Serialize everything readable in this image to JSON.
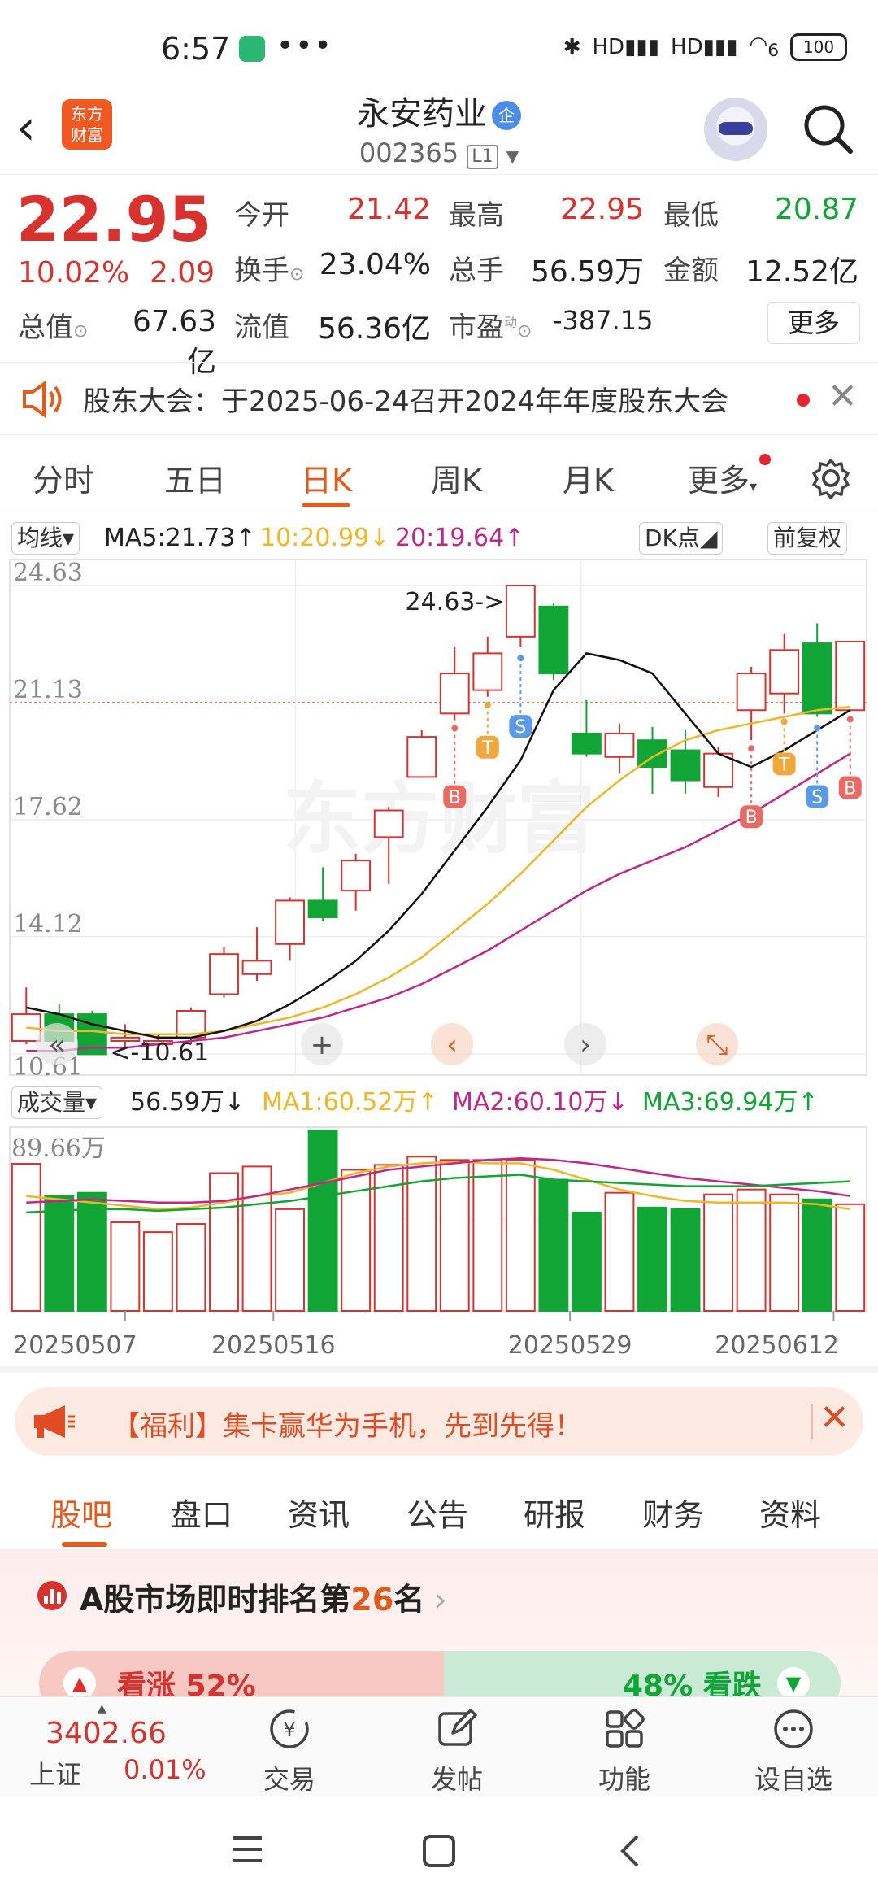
{
  "status_bar": {
    "time": "6:57",
    "dots": "•••",
    "signal1": "HD",
    "signal2": "HD",
    "wifi_label": "6",
    "battery": "100"
  },
  "header": {
    "stock_name": "永安药业",
    "badge": "企",
    "code": "002365",
    "level": "L1",
    "logo_text": "东方财富"
  },
  "quote": {
    "price": "22.95",
    "change_pct": "10.02%",
    "change_abs": "2.09",
    "open_label": "今开",
    "open": "21.42",
    "high_label": "最高",
    "high": "22.95",
    "low_label": "最低",
    "low": "20.87",
    "turnover_label": "换手",
    "turnover": "23.04%",
    "volume_label": "总手",
    "volume": "56.59万",
    "amount_label": "金额",
    "amount": "12.52亿",
    "mktcap_label": "总值",
    "mktcap": "67.63亿",
    "float_label": "流值",
    "float_cap": "56.36亿",
    "pe_label": "市盈",
    "pe_sup": "动",
    "pe": "-387.15",
    "more": "更多"
  },
  "notice": {
    "text": "股东大会：于2025-06-24召开2024年年度股东大会"
  },
  "periods": {
    "tabs": [
      "分时",
      "五日",
      "日K",
      "周K",
      "月K",
      "更多"
    ],
    "active": 2
  },
  "ma_row": {
    "selector": "均线",
    "ma5": "MA5:21.73",
    "ma10": "10:20.99",
    "ma20": "20:19.64",
    "dk": "DK点",
    "adjust": "前复权",
    "ma5_arrow": "↑",
    "ma10_arrow": "↓",
    "ma20_arrow": "↑"
  },
  "vol_row": {
    "selector": "成交量",
    "vol": "56.59万",
    "ma1": "MA1:60.52万",
    "ma2": "MA2:60.10万",
    "ma3": "MA3:69.94万",
    "vol_arrow": "↓",
    "ma1_arrow": "↑",
    "ma2_arrow": "↓",
    "ma3_arrow": "↑"
  },
  "chart_data": {
    "type": "candlestick",
    "y_ticks": [
      "24.63",
      "21.13",
      "17.62",
      "14.12",
      "10.61"
    ],
    "ylim": [
      10.61,
      24.63
    ],
    "x_labels": [
      "20250507",
      "20250516",
      "20250529",
      "20250612"
    ],
    "max_annotation": "24.63->",
    "min_annotation": "<-10.61",
    "vol_max_label": "89.66万",
    "colors": {
      "up": "#d8322f",
      "down": "#11a535",
      "ma5": "#111111",
      "ma10": "#f0b623",
      "ma20": "#c1268a"
    },
    "candles": [
      {
        "o": 11.0,
        "c": 11.8,
        "h": 12.6,
        "l": 10.9
      },
      {
        "o": 11.8,
        "c": 11.0,
        "h": 12.1,
        "l": 10.8
      },
      {
        "o": 11.8,
        "c": 10.6,
        "h": 11.9,
        "l": 10.61
      },
      {
        "o": 11.0,
        "c": 11.1,
        "h": 11.5,
        "l": 10.8
      },
      {
        "o": 10.9,
        "c": 11.0,
        "h": 11.2,
        "l": 10.8
      },
      {
        "o": 11.1,
        "c": 11.9,
        "h": 12.0,
        "l": 10.9
      },
      {
        "o": 12.4,
        "c": 13.6,
        "h": 13.8,
        "l": 12.3
      },
      {
        "o": 13.0,
        "c": 13.4,
        "h": 14.4,
        "l": 12.8
      },
      {
        "o": 13.9,
        "c": 15.2,
        "h": 15.3,
        "l": 13.4
      },
      {
        "o": 15.2,
        "c": 14.7,
        "h": 16.2,
        "l": 14.6
      },
      {
        "o": 15.5,
        "c": 16.4,
        "h": 16.6,
        "l": 14.9
      },
      {
        "o": 17.1,
        "c": 17.9,
        "h": 18.0,
        "l": 15.7
      },
      {
        "o": 18.9,
        "c": 20.1,
        "h": 20.3,
        "l": 18.9
      },
      {
        "o": 20.8,
        "c": 22.0,
        "h": 22.8,
        "l": 20.6
      },
      {
        "o": 21.5,
        "c": 22.6,
        "h": 23.1,
        "l": 21.3
      },
      {
        "o": 23.1,
        "c": 24.63,
        "h": 24.63,
        "l": 22.8
      },
      {
        "o": 24.0,
        "c": 22.0,
        "h": 24.1,
        "l": 21.8
      },
      {
        "o": 20.2,
        "c": 19.6,
        "h": 21.2,
        "l": 19.5
      },
      {
        "o": 19.5,
        "c": 20.2,
        "h": 20.5,
        "l": 19.0
      },
      {
        "o": 20.0,
        "c": 19.2,
        "h": 20.4,
        "l": 18.4
      },
      {
        "o": 19.7,
        "c": 18.8,
        "h": 20.3,
        "l": 18.4
      },
      {
        "o": 18.6,
        "c": 19.6,
        "h": 19.8,
        "l": 18.3
      },
      {
        "o": 20.9,
        "c": 22.0,
        "h": 22.2,
        "l": 20.0
      },
      {
        "o": 21.4,
        "c": 22.7,
        "h": 23.2,
        "l": 20.8
      },
      {
        "o": 22.9,
        "c": 20.8,
        "h": 23.5,
        "l": 20.7
      },
      {
        "o": 20.9,
        "c": 22.95,
        "h": 22.95,
        "l": 20.87
      }
    ],
    "ma5": [
      12.0,
      11.8,
      11.5,
      11.3,
      11.1,
      11.1,
      11.3,
      11.6,
      12.1,
      12.7,
      13.4,
      14.3,
      15.4,
      16.7,
      18.0,
      19.4,
      21.5,
      22.6,
      22.4,
      22.0,
      20.8,
      19.6,
      19.2,
      19.7,
      20.3,
      20.9
    ],
    "ma10": [
      11.4,
      11.3,
      11.3,
      11.2,
      11.2,
      11.2,
      11.3,
      11.5,
      11.7,
      12.0,
      12.4,
      12.9,
      13.5,
      14.3,
      15.1,
      16.0,
      17.0,
      18.0,
      18.8,
      19.5,
      20.0,
      20.3,
      20.5,
      20.7,
      20.9,
      21.0
    ],
    "ma20": [
      10.7,
      10.7,
      10.8,
      10.8,
      10.9,
      11.0,
      11.1,
      11.3,
      11.5,
      11.7,
      12.0,
      12.3,
      12.7,
      13.2,
      13.7,
      14.3,
      14.9,
      15.5,
      16.0,
      16.4,
      16.8,
      17.3,
      17.8,
      18.4,
      19.0,
      19.6
    ],
    "volumes": [
      89.66,
      70,
      72,
      54,
      48,
      53,
      84,
      88,
      62,
      110,
      86,
      89,
      94,
      92,
      92,
      92,
      80,
      60,
      72,
      63,
      62,
      71,
      74,
      71,
      68,
      65
    ],
    "vol_ma1": [
      70,
      68,
      66,
      64,
      62,
      63,
      66,
      70,
      72,
      78,
      84,
      88,
      90,
      91,
      90,
      90,
      86,
      80,
      74,
      70,
      67,
      66,
      66,
      66,
      65,
      62
    ],
    "vol_ma2": [
      66,
      67,
      68,
      67,
      66,
      66,
      67,
      70,
      74,
      78,
      82,
      86,
      88,
      90,
      92,
      93,
      92,
      90,
      87,
      84,
      81,
      79,
      77,
      75,
      73,
      70
    ],
    "vol_ma3": [
      60,
      61,
      62,
      62,
      61,
      62,
      63,
      65,
      67,
      70,
      73,
      76,
      79,
      81,
      82,
      83,
      80,
      79,
      78,
      77,
      76,
      76,
      76,
      77,
      78,
      79
    ],
    "signals": [
      {
        "i": 13,
        "label": "B",
        "kind": "buy"
      },
      {
        "i": 14,
        "label": "T",
        "kind": "t"
      },
      {
        "i": 15,
        "label": "S",
        "kind": "sell"
      },
      {
        "i": 22,
        "label": "B",
        "kind": "buy"
      },
      {
        "i": 23,
        "label": "T",
        "kind": "t"
      },
      {
        "i": 24,
        "label": "S",
        "kind": "sell"
      },
      {
        "i": 25,
        "label": "B",
        "kind": "buy"
      }
    ]
  },
  "banner": {
    "text": "【福利】集卡赢华为手机，先到先得！"
  },
  "content_tabs": {
    "tabs": [
      "股吧",
      "盘口",
      "资讯",
      "公告",
      "研报",
      "财务",
      "资料"
    ],
    "active": 0
  },
  "rank": {
    "prefix": "A股市场即时排名第",
    "num": "26",
    "suffix": "名",
    "up_text": "看涨 52%",
    "down_text": "48% 看跌",
    "up_pct": 52
  },
  "bottom_nav": {
    "index_value": "3402.66",
    "index_name": "上证",
    "index_change": "0.01%",
    "items": [
      "交易",
      "发帖",
      "功能",
      "设自选"
    ]
  }
}
